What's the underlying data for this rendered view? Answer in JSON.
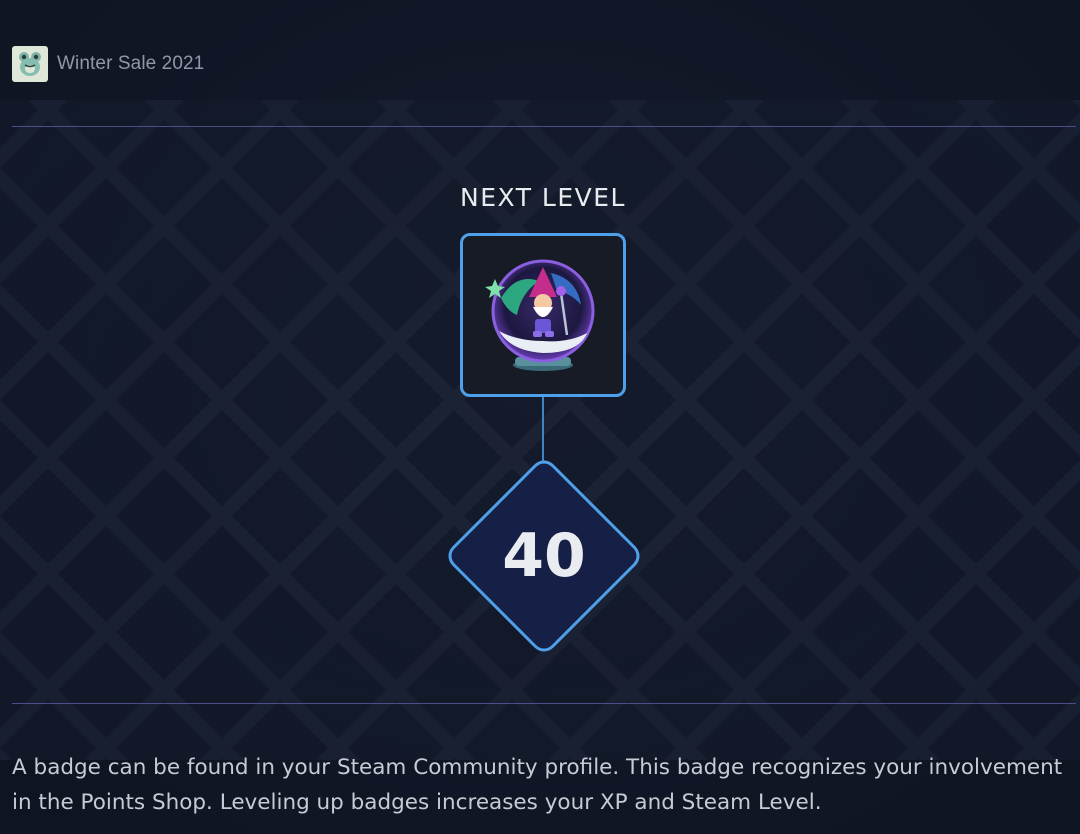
{
  "header": {
    "breadcrumb": "Winter Sale 2021",
    "app_icon": "frog-badge-icon"
  },
  "badge": {
    "heading": "NEXT LEVEL",
    "image": "gnome-snow-globe-icon",
    "level": "40"
  },
  "description": "A badge can be found in your Steam Community profile. This badge recognizes your involvement in the Points Shop. Leveling up badges increases your XP and Steam Level.",
  "colors": {
    "background": "#141b2c",
    "accent_blue": "#4ea0ea",
    "divider": "#4a4f8a",
    "diamond_fill": "#161f45"
  }
}
